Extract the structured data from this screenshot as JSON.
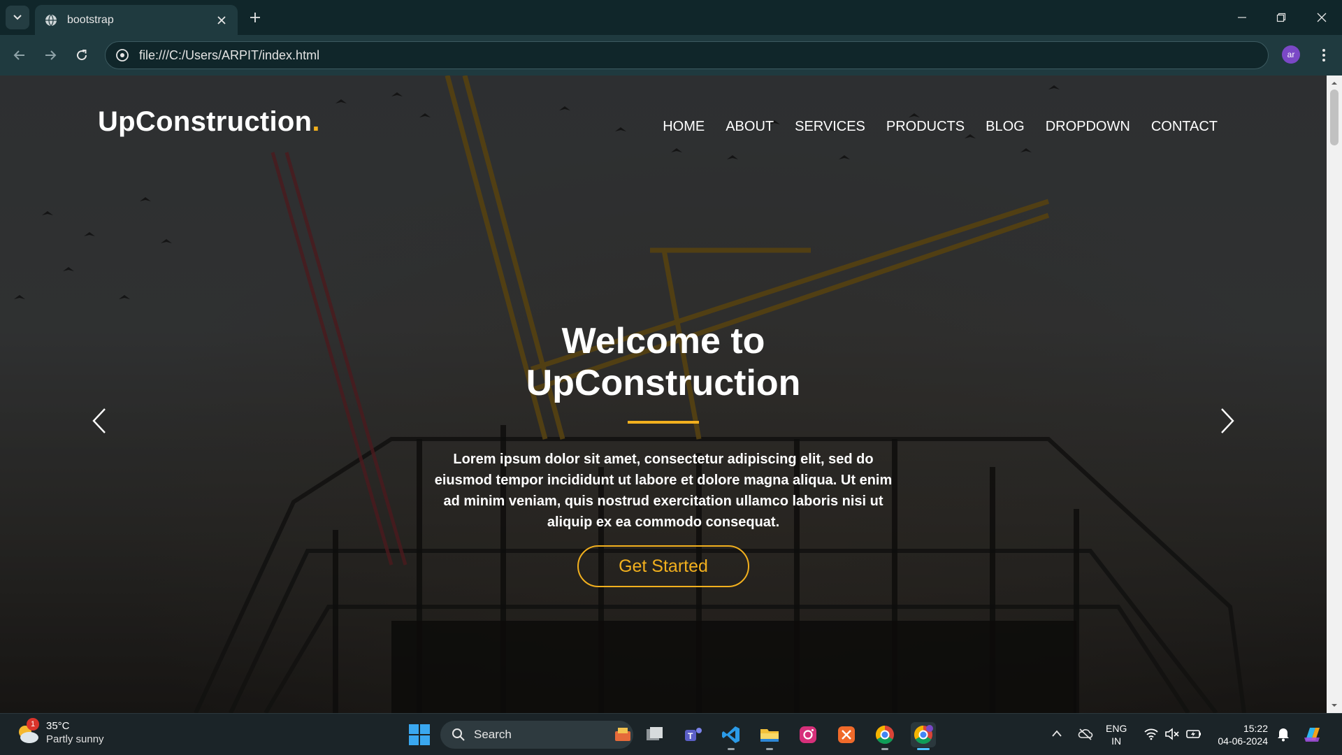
{
  "browser": {
    "tab_title": "bootstrap",
    "url": "file:///C:/Users/ARPIT/index.html",
    "profile_initials": "ar"
  },
  "site": {
    "logo_text": "UpConstruction",
    "logo_dot": ".",
    "nav": [
      "HOME",
      "ABOUT",
      "SERVICES",
      "PRODUCTS",
      "BLOG",
      "DROPDOWN",
      "CONTACT"
    ],
    "hero": {
      "title_line1": "Welcome to",
      "title_line2": "UpConstruction",
      "text": "Lorem ipsum dolor sit amet, consectetur adipiscing elit, sed do eiusmod tempor incididunt ut labore et dolore magna aliqua. Ut enim ad minim veniam, quis nostrud exercitation ullamco laboris nisi ut aliquip ex ea commodo consequat.",
      "button": "Get Started"
    },
    "accent_color": "#f2b01e"
  },
  "taskbar": {
    "weather_temp": "35°C",
    "weather_cond": "Partly sunny",
    "weather_badge": "1",
    "search_label": "Search",
    "lang_line1": "ENG",
    "lang_line2": "IN",
    "time": "15:22",
    "date": "04-06-2024",
    "pinned_icons": [
      "task-view-icon",
      "teams-icon",
      "vscode-icon",
      "file-explorer-icon",
      "instagram-icon",
      "app-icon",
      "chrome-icon",
      "chrome-profile-icon"
    ]
  }
}
